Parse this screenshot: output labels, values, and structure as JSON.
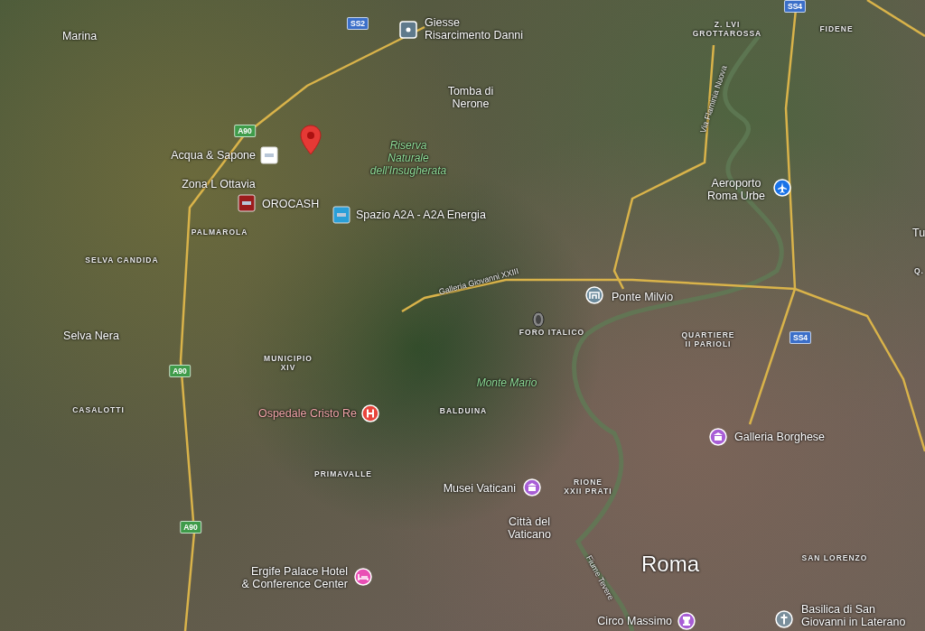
{
  "map": {
    "labels": [
      {
        "kind": "place",
        "text": "Marina"
      },
      {
        "kind": "poi",
        "text": "Giesse\nRisarcimento Danni",
        "color": "#5f7a8c"
      },
      {
        "kind": "place",
        "text": "Tomba di\nNerone"
      },
      {
        "kind": "district",
        "text": "Z. LVI\nGROTTAROSSA"
      },
      {
        "kind": "district",
        "text": "FIDENE"
      },
      {
        "kind": "poi",
        "text": "Acqua & Sapone",
        "color": "#ffffff"
      },
      {
        "kind": "park",
        "text": "Riserva\nNaturale\ndell'Insugherata"
      },
      {
        "kind": "place",
        "text": "Zona L Ottavia"
      },
      {
        "kind": "poi",
        "text": "OROCASH",
        "color": "#9b1c1c"
      },
      {
        "kind": "poi",
        "text": "Spazio A2A - A2A Energia",
        "color": "#2a9fd8"
      },
      {
        "kind": "road",
        "text": "Via Flaminia Nuova"
      },
      {
        "kind": "poi",
        "text": "Aeroporto\nRoma Urbe",
        "color": "#1a73e8"
      },
      {
        "kind": "district",
        "text": "PALMAROLA"
      },
      {
        "kind": "place",
        "text": "Tu"
      },
      {
        "kind": "district",
        "text": "SELVA CANDIDA"
      },
      {
        "kind": "district",
        "text": "Q."
      },
      {
        "kind": "road",
        "text": "Galleria Giovanni XXIII"
      },
      {
        "kind": "poi",
        "text": "Ponte Milvio",
        "color": "#6b8a9c"
      },
      {
        "kind": "place",
        "text": "Selva Nera"
      },
      {
        "kind": "district",
        "text": "FORO ITALICO"
      },
      {
        "kind": "district",
        "text": "QUARTIERE\nII PARIOLI"
      },
      {
        "kind": "district",
        "text": "MUNICIPIO\nXIV"
      },
      {
        "kind": "park",
        "text": "Monte Mario"
      },
      {
        "kind": "district",
        "text": "CASALOTTI"
      },
      {
        "kind": "hospital",
        "text": "Ospedale Cristo Re",
        "color": "#e8453c"
      },
      {
        "kind": "district",
        "text": "BALDUINA"
      },
      {
        "kind": "poi",
        "text": "Galleria Borghese",
        "color": "#a85ed6"
      },
      {
        "kind": "district",
        "text": "PRIMAVALLE"
      },
      {
        "kind": "poi",
        "text": "Musei Vaticani",
        "color": "#a85ed6"
      },
      {
        "kind": "district",
        "text": "RIONE\nXXII PRATI"
      },
      {
        "kind": "place",
        "text": "Città del\nVaticano"
      },
      {
        "kind": "poi",
        "text": "Ergife Palace Hotel\n& Conference Center",
        "color": "#e94fb5"
      },
      {
        "kind": "road",
        "text": "Fiume Tevere"
      },
      {
        "kind": "city",
        "text": "Roma"
      },
      {
        "kind": "district",
        "text": "SAN LORENZO"
      },
      {
        "kind": "poi",
        "text": "Circo Massimo",
        "color": "#a85ed6"
      },
      {
        "kind": "poi",
        "text": "Basilica di San\nGiovanni in Laterano",
        "color": "#7a8f9c"
      }
    ],
    "road_shields": [
      {
        "text": "SS2",
        "color": "#3b6fc9"
      },
      {
        "text": "SS4",
        "color": "#3b6fc9"
      },
      {
        "text": "A90",
        "color": "#3f9b4a"
      },
      {
        "text": "A90",
        "color": "#3f9b4a"
      },
      {
        "text": "A90",
        "color": "#3f9b4a"
      },
      {
        "text": "SS4",
        "color": "#3b6fc9"
      }
    ]
  }
}
